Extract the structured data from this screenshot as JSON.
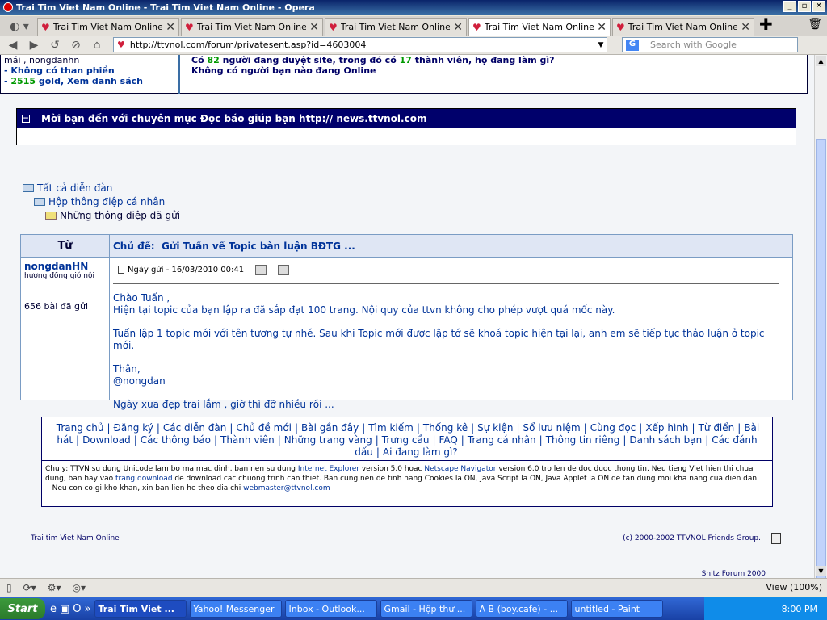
{
  "window": {
    "title": "Trai Tim Viet Nam Online - Trai Tim Viet Nam Online - Opera"
  },
  "tabs": [
    {
      "label": "Trai Tim Viet Nam Online ..."
    },
    {
      "label": "Trai Tim Viet Nam Online ..."
    },
    {
      "label": "Trai Tim Viet Nam Online ..."
    },
    {
      "label": "Trai Tim Viet Nam Online ..."
    },
    {
      "label": "Trai Tim Viet Nam Online ..."
    }
  ],
  "address": {
    "url": "http://ttvnol.com/forum/privatesent.asp?id=4603004",
    "search_placeholder": "Search with Google"
  },
  "top_panel": {
    "members_line": "mái , nongdanhn",
    "no_birthday": "- Không có than phiền",
    "gold_count": "2515",
    "gold_text": "gold, Xem danh sách",
    "online_prefix": "Có",
    "online_count": "82",
    "online_middle": "người đang duyệt site, trong đó có",
    "member_count": "17",
    "online_suffix": "thành viên, họ đang làm gì?",
    "friends_online": "Không có người bạn nào đang Online"
  },
  "announcement": {
    "text": "Mời bạn đến với chuyên mục Đọc báo giúp bạn http:// news.ttvnol.com"
  },
  "breadcrumb": {
    "items": [
      "Tất cả diễn đàn",
      "Hộp thông điệp cá nhân",
      "Những thông điệp đã gửi"
    ]
  },
  "message": {
    "from_header": "Từ",
    "subject_label": "Chủ đề:",
    "subject": "Gửi Tuấn về Topic bàn luận BĐTG ...",
    "sender_name": "nongdanHN",
    "sender_title": "hương đồng gió nội",
    "post_count": "656 bài đã gửi",
    "date_label": "Ngày gửi - 16/03/2010  00:41",
    "body": [
      "Chào Tuấn ,",
      "Hiện tại topic của bạn lập ra đã sắp đạt 100 trang. Nội quy của ttvn không cho phép vượt quá mốc này.",
      "Tuấn lập 1 topic mới với tên tương tự nhé. Sau khi Topic mới được lập tớ sẽ khoá topic hiện tại lại, anh em sẽ tiếp tục thảo luận ở topic mới.",
      "Thân,",
      "@nongdan",
      "Ngày xưa đẹp trai lắm , giờ thì đỡ nhiều rồi ..."
    ]
  },
  "footer_links": [
    "Trang chủ",
    "Đăng ký",
    "Các diễn đàn",
    "Chủ đề mới",
    "Bài gần đây",
    "Tìm kiếm",
    "Thống kê",
    "Sự kiện",
    "Sổ lưu niệm",
    "Cùng đọc",
    "Xếp hình",
    "Từ điển",
    "Bài hát",
    "Download",
    "Các thông báo",
    "Thành viên",
    "Những trang vàng",
    "Trưng cầu",
    "FAQ",
    "Trang cá nhân",
    "Thông tin riêng",
    "Danh sách bạn",
    "Các đánh dấu",
    "Ai đang làm gì?"
  ],
  "footer_note": {
    "line1_a": "Chu y: TTVN su dung Unicode lam bo ma mac dinh, ban nen su dung",
    "ie": "Internet Explorer",
    "line1_b": "version 5.0 hoac",
    "netscape": "Netscape Navigator",
    "line1_c": "version 6.0 tro len de doc duoc thong tin. Neu tieng Viet hien thi chua dung, ban hay vao",
    "download": "trang download",
    "line1_d": "de download cac chuong trinh can thiet. Ban cung nen de tinh nang Cookies la ON, Java Script la ON, Java Applet la ON de tan dung moi kha nang cua dien dan.",
    "line2_a": "Neu con co gi kho khan, xin ban lien he theo dia chi",
    "email": "webmaster@ttvnol.com"
  },
  "page_footer": {
    "left": "Trai tim Viet Nam Online",
    "right": "(c) 2000-2002 TTVNOL Friends Group.",
    "spitz": "Snitz Forum 2000"
  },
  "status": {
    "zoom": "View (100%)"
  },
  "taskbar": {
    "start": "Start",
    "items": [
      {
        "label": "Trai Tim Viet ...",
        "active": true
      },
      {
        "label": "Yahoo! Messenger",
        "active": false
      },
      {
        "label": "Inbox - Outlook...",
        "active": false
      },
      {
        "label": "Gmail - Hộp thư ...",
        "active": false
      },
      {
        "label": "A B (boy.cafe) - ...",
        "active": false
      },
      {
        "label": "untitled - Paint",
        "active": false
      }
    ],
    "clock": "8:00 PM"
  }
}
